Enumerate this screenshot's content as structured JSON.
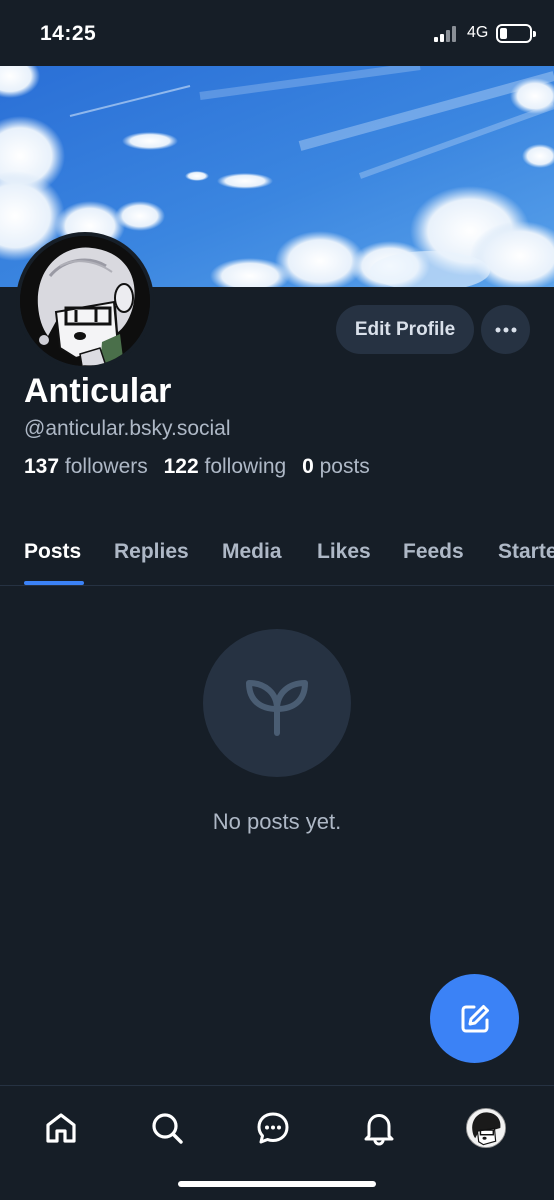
{
  "status_bar": {
    "time": "14:25",
    "network": "4G"
  },
  "profile": {
    "display_name": "Anticular",
    "handle": "@anticular.bsky.social",
    "followers_count": "137",
    "followers_label": "followers",
    "following_count": "122",
    "following_label": "following",
    "posts_count": "0",
    "posts_label": "posts"
  },
  "actions": {
    "edit_profile_label": "Edit Profile"
  },
  "tabs": [
    {
      "label": "Posts",
      "active": true
    },
    {
      "label": "Replies"
    },
    {
      "label": "Media"
    },
    {
      "label": "Likes"
    },
    {
      "label": "Feeds"
    },
    {
      "label": "Starter Packs"
    }
  ],
  "empty_state": {
    "message": "No posts yet.",
    "icon": "sprout-icon"
  },
  "bottom_nav": [
    "home-icon",
    "search-icon",
    "chat-icon",
    "bell-icon",
    "avatar"
  ],
  "colors": {
    "accent": "#3b82f6",
    "background": "#161e27",
    "surface": "#263242",
    "muted_text": "#aeb8c6"
  }
}
